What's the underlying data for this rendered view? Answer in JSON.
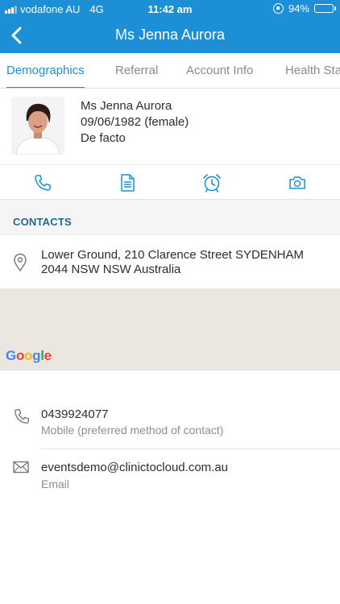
{
  "status_bar": {
    "carrier": "vodafone AU",
    "network": "4G",
    "time": "11:42 am",
    "battery": "94%",
    "battery_level": 0.94
  },
  "nav": {
    "title": "Ms Jenna Aurora"
  },
  "tabs": [
    {
      "label": "Demographics",
      "active": true
    },
    {
      "label": "Referral",
      "active": false
    },
    {
      "label": "Account Info",
      "active": false
    },
    {
      "label": "Health Sta",
      "active": false
    }
  ],
  "profile": {
    "name": "Ms Jenna Aurora",
    "dob": "09/06/1982 (female)",
    "relationship": "De facto"
  },
  "actions": [
    "phone-icon",
    "document-icon",
    "alarm-clock-icon",
    "camera-icon"
  ],
  "contacts": {
    "section_title": "CONTACTS",
    "address_line1": "Lower Ground, 210 Clarence Street SYDENHAM",
    "address_line2": "2044 NSW NSW Australia",
    "map_logo": "Google",
    "phone": {
      "value": "0439924077",
      "label": "Mobile (preferred method of contact)"
    },
    "email": {
      "value": "eventsdemo@clinictocloud.com.au",
      "label": "Email"
    }
  },
  "colors": {
    "brand_blue": "#1d8fd6",
    "section_title": "#1c6a90",
    "map_bg": "#ebe6df"
  }
}
